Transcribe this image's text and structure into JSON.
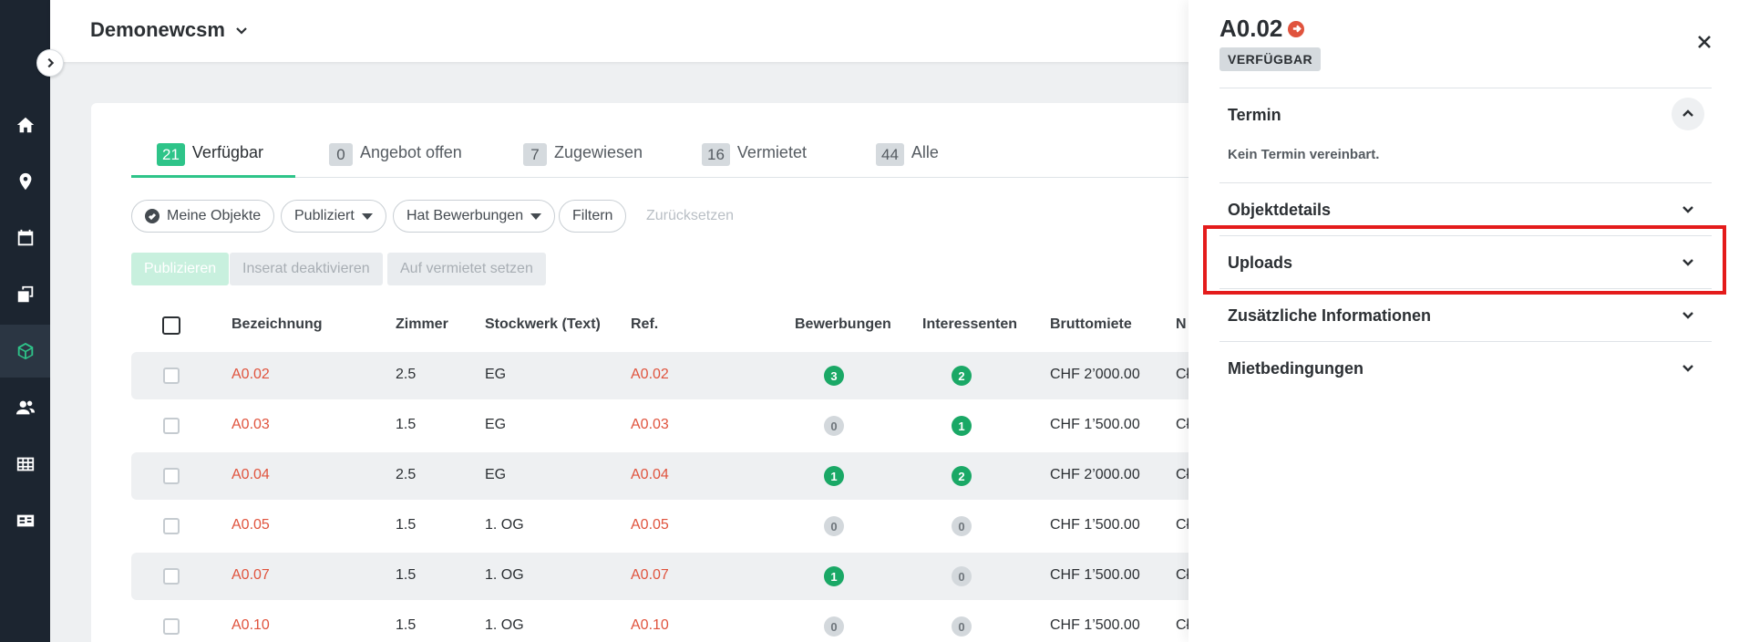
{
  "topbar": {
    "project_title": "Demonewcsm"
  },
  "nav": {
    "items": [
      "home-icon",
      "location-pin-icon",
      "calendar-icon",
      "copy-icon",
      "cube-icon",
      "users-icon",
      "table-icon",
      "id-card-icon"
    ],
    "active": "cube-icon"
  },
  "tabs": [
    {
      "count": "21",
      "label": "Verfügbar"
    },
    {
      "count": "0",
      "label": "Angebot offen"
    },
    {
      "count": "7",
      "label": "Zugewiesen"
    },
    {
      "count": "16",
      "label": "Vermietet"
    },
    {
      "count": "44",
      "label": "Alle"
    }
  ],
  "filters": {
    "my_objects": "Meine Objekte",
    "published": "Publiziert",
    "has_applications": "Hat Bewerbungen",
    "filter": "Filtern",
    "reset": "Zurücksetzen"
  },
  "actions": {
    "publish": "Publizieren",
    "deactivate": "Inserat deaktivieren",
    "set_rented": "Auf vermietet setzen"
  },
  "table": {
    "headers": {
      "name": "Bezeichnung",
      "rooms": "Zimmer",
      "floor": "Stockwerk (Text)",
      "ref": "Ref.",
      "applications": "Bewerbungen",
      "interested": "Interessenten",
      "gross_rent": "Bruttomiete",
      "net": "N"
    },
    "rows": [
      {
        "name": "A0.02",
        "rooms": "2.5",
        "floor": "EG",
        "ref": "A0.02",
        "applications": "3",
        "interested": "2",
        "gross_rent": "CHF 2’000.00",
        "net": "Cł"
      },
      {
        "name": "A0.03",
        "rooms": "1.5",
        "floor": "EG",
        "ref": "A0.03",
        "applications": "0",
        "interested": "1",
        "gross_rent": "CHF 1’500.00",
        "net": "Cł"
      },
      {
        "name": "A0.04",
        "rooms": "2.5",
        "floor": "EG",
        "ref": "A0.04",
        "applications": "1",
        "interested": "2",
        "gross_rent": "CHF 2’000.00",
        "net": "Cł"
      },
      {
        "name": "A0.05",
        "rooms": "1.5",
        "floor": "1. OG",
        "ref": "A0.05",
        "applications": "0",
        "interested": "0",
        "gross_rent": "CHF 1’500.00",
        "net": "Cł"
      },
      {
        "name": "A0.07",
        "rooms": "1.5",
        "floor": "1. OG",
        "ref": "A0.07",
        "applications": "1",
        "interested": "0",
        "gross_rent": "CHF 1’500.00",
        "net": "Cł"
      },
      {
        "name": "A0.10",
        "rooms": "1.5",
        "floor": "1. OG",
        "ref": "A0.10",
        "applications": "0",
        "interested": "0",
        "gross_rent": "CHF 1’500.00",
        "net": "Cł"
      }
    ]
  },
  "drawer": {
    "title": "A0.02",
    "status": "VERFÜGBAR",
    "sections": {
      "appointment": {
        "label": "Termin",
        "body": "Kein Termin vereinbart."
      },
      "details": {
        "label": "Objektdetails"
      },
      "uploads": {
        "label": "Uploads"
      },
      "additional": {
        "label": "Zusätzliche Informationen"
      },
      "conditions": {
        "label": "Mietbedingungen"
      }
    }
  },
  "colors": {
    "accent_green": "#2ec489",
    "link_red": "#e0533d",
    "nav_bg": "#1c2530",
    "highlight_red": "#e41b1b"
  }
}
